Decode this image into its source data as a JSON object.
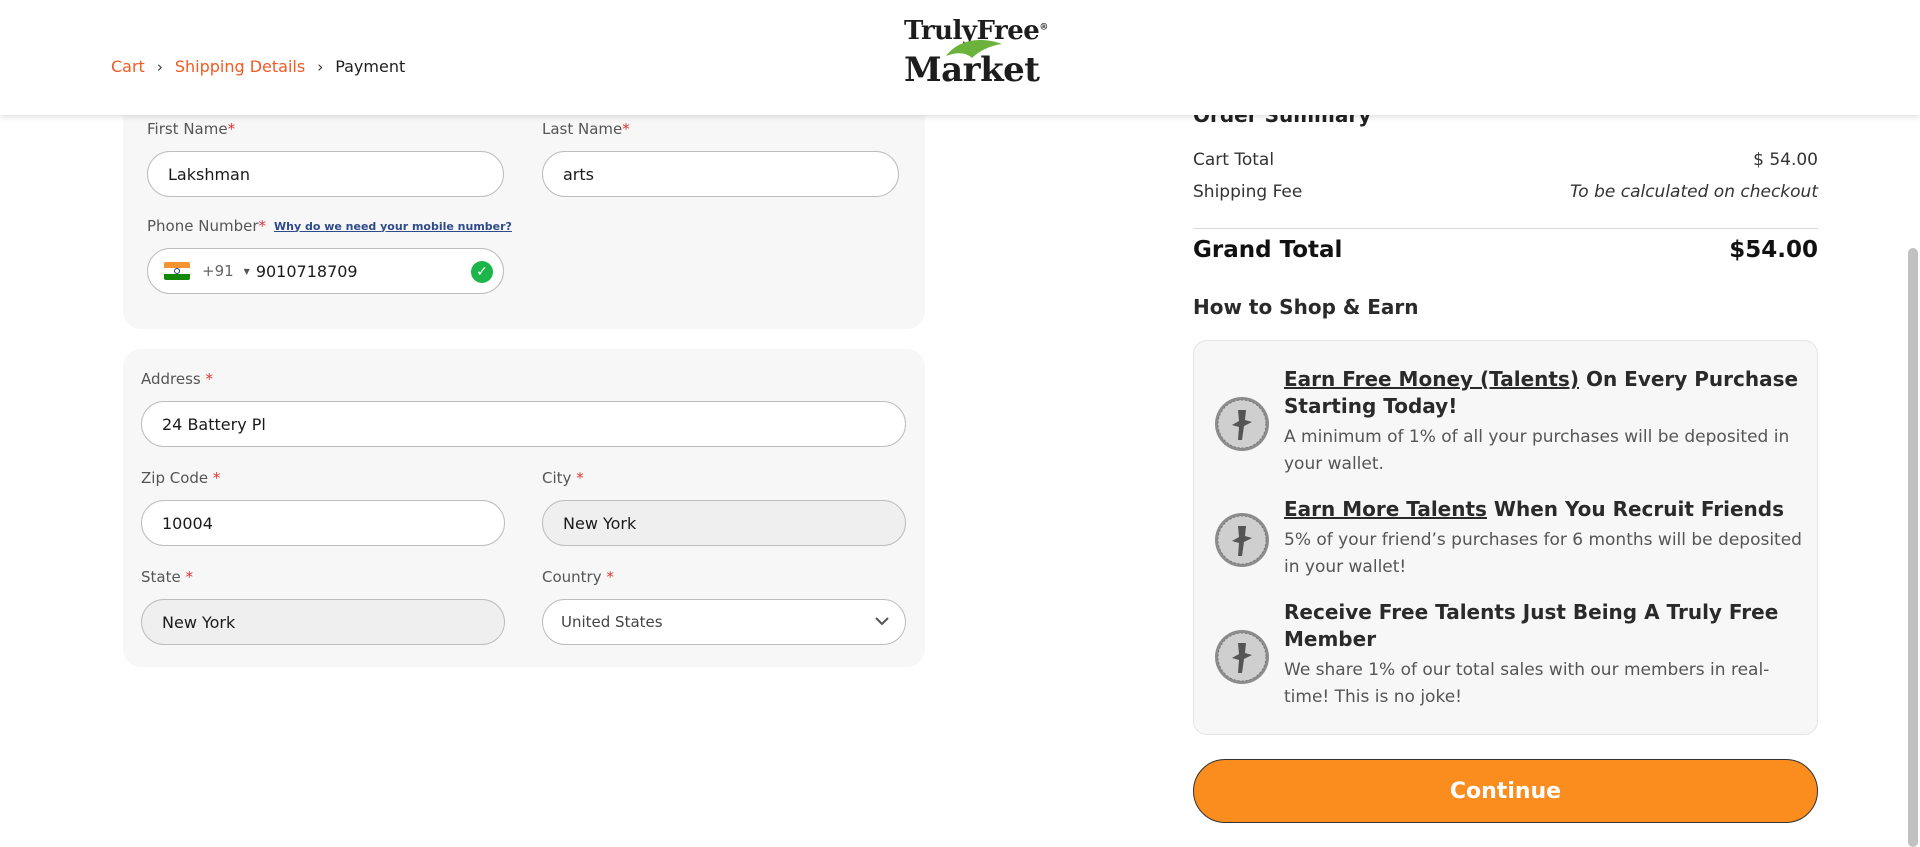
{
  "breadcrumb": {
    "cart": "Cart",
    "shipping": "Shipping Details",
    "payment": "Payment"
  },
  "logo": {
    "top": "TrulyFree",
    "bottom": "Market",
    "tm": "®"
  },
  "form": {
    "first_name": {
      "label": "First Name",
      "value": "Lakshman"
    },
    "last_name": {
      "label": "Last Name",
      "value": "arts"
    },
    "phone": {
      "label": "Phone Number",
      "why_link": "Why do we need your mobile number?",
      "dial_code": "+91",
      "value": "9010718709"
    },
    "address": {
      "label": "Address",
      "value": "24 Battery Pl"
    },
    "zip": {
      "label": "Zip Code",
      "value": "10004"
    },
    "city": {
      "label": "City",
      "value": "New York"
    },
    "state": {
      "label": "State",
      "value": "New York"
    },
    "country": {
      "label": "Country",
      "value": "United States"
    },
    "required_mark": "*"
  },
  "summary": {
    "title": "Order Summary",
    "cart_total_label": "Cart Total",
    "cart_total_value": "$ 54.00",
    "shipping_label": "Shipping Fee",
    "shipping_value": "To be calculated on checkout",
    "grand_label": "Grand Total",
    "grand_value": "$54.00",
    "how_title": "How to Shop & Earn"
  },
  "earn": {
    "item1": {
      "link": "Earn Free Money (Talents)",
      "rest": " On Every Purchase Starting Today!",
      "desc": "A minimum of 1% of all your purchases will be deposited in your wallet."
    },
    "item2": {
      "link": "Earn More Talents",
      "rest": " When You Recruit Friends",
      "desc": "5% of your friend’s purchases for 6 months will be deposited in your wallet!"
    },
    "item3": {
      "head": "Receive Free Talents Just Being A Truly Free Member",
      "desc": "We share 1% of our total sales with our members in real-time! This is no joke!"
    }
  },
  "continue_label": "Continue",
  "colors": {
    "accent": "#f05a23",
    "button": "#fb8c1e",
    "check": "#1bb54a",
    "leaf": "#6cb33e"
  },
  "icons": [
    "chevron-right-icon",
    "india-flag-icon",
    "caret-down-icon",
    "check-circle-icon",
    "chevron-down-icon",
    "talent-coin-icon"
  ]
}
